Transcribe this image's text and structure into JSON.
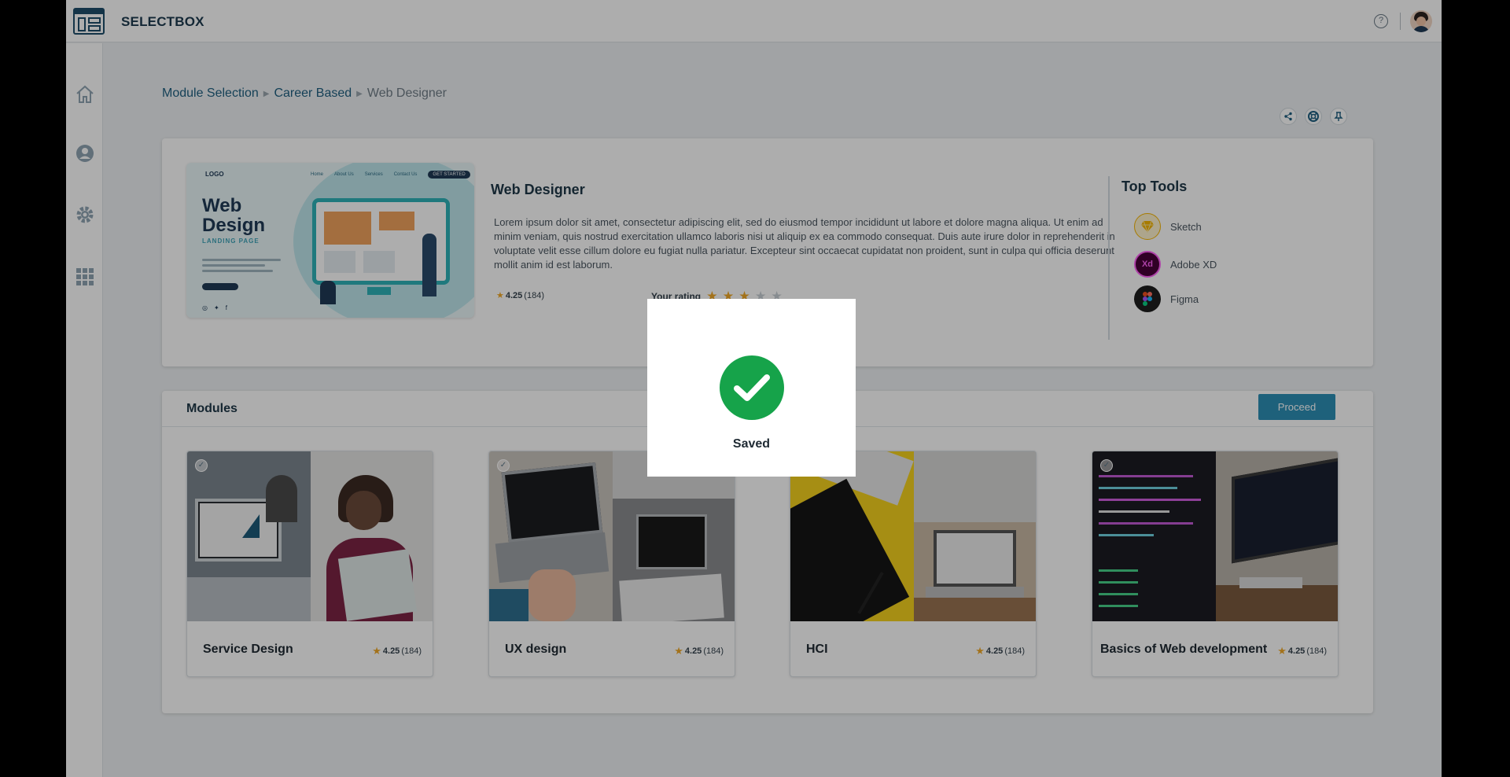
{
  "app": {
    "title": "SELECTBOX"
  },
  "breadcrumb": {
    "items": [
      "Module Selection",
      "Career Based"
    ],
    "current": "Web Designer",
    "separator": "▶"
  },
  "career": {
    "title": "Web Designer",
    "description": "Lorem ipsum dolor sit amet, consectetur adipiscing elit, sed do eiusmod tempor incididunt ut labore et dolore magna aliqua. Ut enim ad minim veniam, quis nostrud exercitation ullamco laboris nisi ut aliquip ex ea commodo consequat. Duis aute irure dolor in reprehenderit in voluptate velit esse cillum dolore eu fugiat nulla pariatur. Excepteur sint occaecat cupidatat non proident, sunt in culpa qui officia deserunt mollit anim id est laborum.",
    "rating": "4.25",
    "rating_count": "(184)",
    "your_rating_label": "Your rating",
    "your_rating_value": 3,
    "your_rating_max": 5,
    "hero": {
      "logo": "LOGO",
      "nav": [
        "Home",
        "About Us",
        "Services",
        "Contact Us"
      ],
      "cta": "GET STARTED",
      "headline": "Web Design",
      "subline": "LANDING PAGE"
    }
  },
  "top_tools": {
    "title": "Top Tools",
    "items": [
      {
        "name": "Sketch",
        "icon": "sketch-icon",
        "color": "#f7b500"
      },
      {
        "name": "Adobe XD",
        "icon": "adobe-xd-icon",
        "badge": "Xd",
        "color": "#ff2bc2"
      },
      {
        "name": "Figma",
        "icon": "figma-icon",
        "color": "#1e1e1e"
      }
    ]
  },
  "modules": {
    "title": "Modules",
    "proceed_label": "Proceed",
    "items": [
      {
        "name": "Service Design",
        "rating": "4.25",
        "count": "(184)"
      },
      {
        "name": "UX design",
        "rating": "4.25",
        "count": "(184)"
      },
      {
        "name": "HCI",
        "rating": "4.25",
        "count": "(184)"
      },
      {
        "name": "Basics of Web development",
        "rating": "4.25",
        "count": "(184)"
      }
    ]
  },
  "dialog": {
    "label": "Saved",
    "icon": "check-icon",
    "color": "#16a34a"
  },
  "colors": {
    "accent": "#2d8fb5",
    "star": "#f0a928",
    "brand": "#1e4d6b"
  }
}
